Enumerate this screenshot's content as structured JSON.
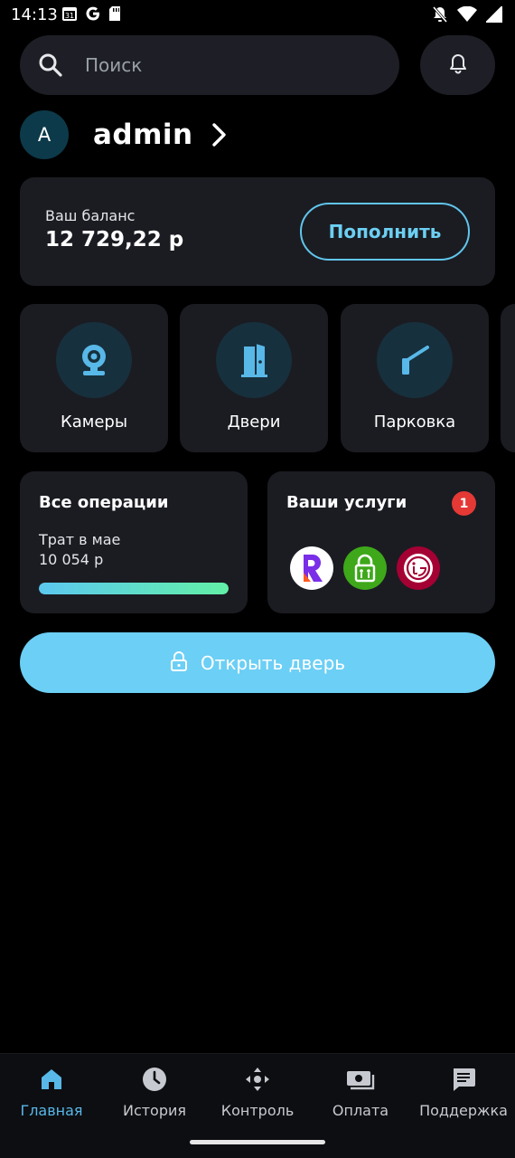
{
  "status_bar": {
    "time": "14:13",
    "icons": [
      "calendar-icon",
      "google-icon",
      "sd-card-icon",
      "bell-off-icon",
      "wifi-icon",
      "signal-icon"
    ]
  },
  "search": {
    "placeholder": "Поиск"
  },
  "profile": {
    "initial": "A",
    "name": "admin"
  },
  "balance": {
    "label": "Ваш баланс",
    "value": "12 729,22 р",
    "topup_label": "Пополнить"
  },
  "tiles": [
    {
      "label": "Камеры",
      "icon": "camera-icon"
    },
    {
      "label": "Двери",
      "icon": "door-icon"
    },
    {
      "label": "Парковка",
      "icon": "barrier-icon"
    }
  ],
  "operations": {
    "title": "Все операции",
    "subtitle": "Трат в мае",
    "value": "10 054 р",
    "progress": 1.0
  },
  "services": {
    "title": "Ваши услуги",
    "badge": "1",
    "logos": [
      "rostelecom-logo",
      "lock-app-logo",
      "lg-logo"
    ]
  },
  "open_door": {
    "label": "Открыть дверь",
    "icon": "lock-icon"
  },
  "nav": [
    {
      "label": "Главная",
      "icon": "home-icon",
      "active": true
    },
    {
      "label": "История",
      "icon": "clock-icon",
      "active": false
    },
    {
      "label": "Контроль",
      "icon": "move-icon",
      "active": false
    },
    {
      "label": "Оплата",
      "icon": "payment-icon",
      "active": false
    },
    {
      "label": "Поддержка",
      "icon": "chat-icon",
      "active": false
    }
  ],
  "colors": {
    "accent": "#6ccff5",
    "card": "#1b1c22",
    "background": "#000000",
    "badge": "#e53935",
    "nav_active": "#58b8e8"
  }
}
